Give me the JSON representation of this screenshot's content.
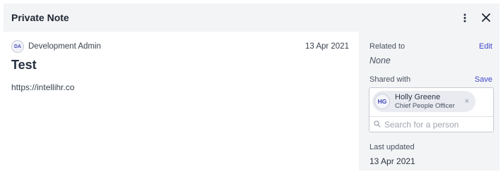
{
  "modal": {
    "title": "Private Note"
  },
  "note": {
    "author_initials": "DA",
    "author_name": "Development Admin",
    "date": "13 Apr 2021",
    "title": "Test",
    "body": "https://intellihr.co"
  },
  "sidebar": {
    "related_label": "Related to",
    "related_edit": "Edit",
    "related_value": "None",
    "shared_label": "Shared with",
    "shared_save": "Save",
    "shared_people": [
      {
        "initials": "HG",
        "name": "Holly Greene",
        "role": "Chief People Officer",
        "remove": "×"
      }
    ],
    "search_placeholder": "Search for a person",
    "updated_label": "Last updated",
    "updated_value": "13 Apr 2021"
  },
  "colors": {
    "accent": "#3f45c9",
    "panel_bg": "#f3f4f6"
  },
  "icons": {
    "more": "kebab-menu-icon",
    "close": "close-icon",
    "search": "search-icon"
  }
}
